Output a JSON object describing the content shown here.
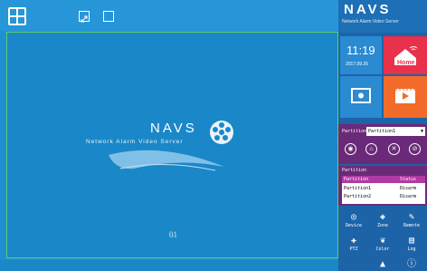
{
  "logo": {
    "title": "NAVS",
    "subtitle": "Network Alarm Video Server"
  },
  "video": {
    "channel": "01"
  },
  "brand": {
    "title": "NAVS",
    "subtitle": "Network Alarm Video Server"
  },
  "clock": {
    "time": "11:19",
    "date": "2017.09.26"
  },
  "home_tile": {
    "label": "Home"
  },
  "partition": {
    "label": "Partition",
    "selected": "Partition1"
  },
  "partition_table": {
    "title": "Partition",
    "headers": [
      "Partition",
      "Status"
    ],
    "rows": [
      [
        "Partition1",
        "Disarm"
      ],
      [
        "Partition2",
        "Disarm"
      ]
    ]
  },
  "nav": [
    "Device",
    "Zone",
    "Remote",
    "PTZ",
    "Color",
    "Log"
  ],
  "colors": {
    "accent_green": "#7dc242",
    "panel_purple": "#6b2a79",
    "home_red": "#e8314a",
    "orange": "#f26b2a",
    "blue_tile": "#2a8ad2"
  }
}
